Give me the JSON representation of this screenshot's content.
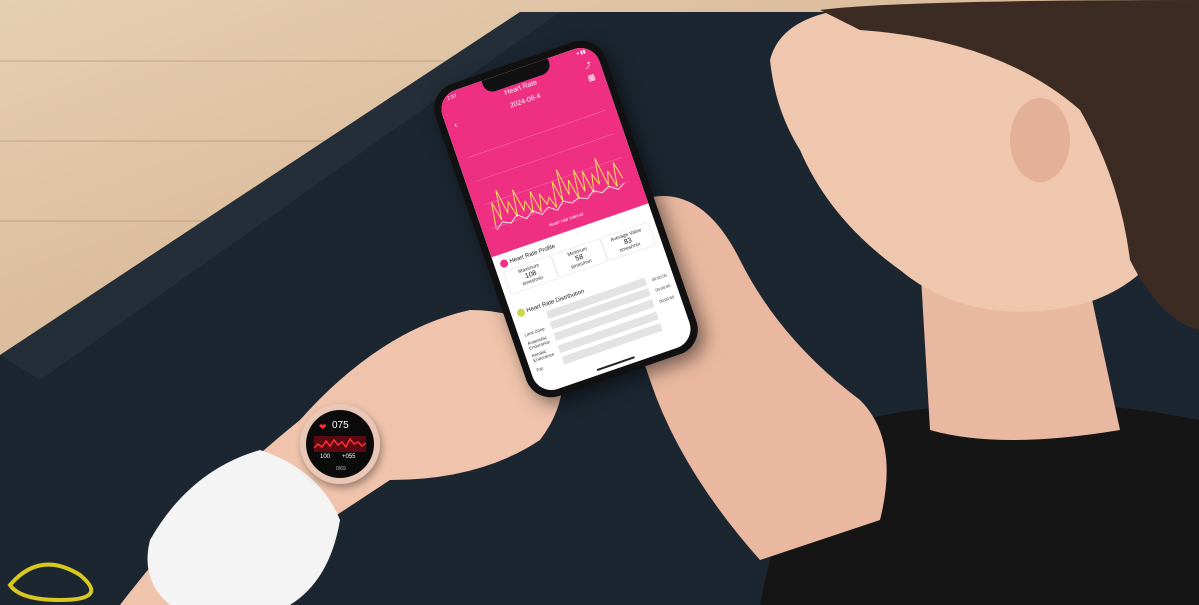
{
  "phone": {
    "status_time": "2:37",
    "status_right": "▾ ▮▮",
    "title": "Heart Rate",
    "date": "2024-08-4",
    "legend": "Heart rate interval",
    "profile": {
      "title": "Heart Rate Profile",
      "maximum_label": "Maximum",
      "maximum_value": "108",
      "maximum_unit": "times/min",
      "minimum_label": "Minimum",
      "minimum_value": "58",
      "minimum_unit": "times/min",
      "average_label": "Average Value",
      "average_value": "83",
      "average_unit": "times/min"
    },
    "distribution": {
      "title": "Heart Rate Distribution",
      "rows": [
        {
          "label": "",
          "value": "00:00:00"
        },
        {
          "label": "Limit Zone",
          "value": "00:00:00"
        },
        {
          "label": "Anaerobic Endurance",
          "value": "00:00:00"
        },
        {
          "label": "Aerobic Endurance",
          "value": ""
        },
        {
          "label": "Fat",
          "value": ""
        }
      ]
    }
  },
  "watch": {
    "heart_rate": "075",
    "left_value": "100",
    "right_value": "+055",
    "bottom": "0/69"
  },
  "colors": {
    "accent_pink": "#ee2f82",
    "watch_band": "#e9c6b6"
  }
}
